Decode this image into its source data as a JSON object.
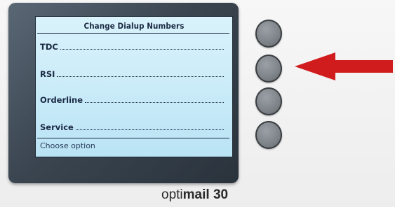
{
  "screen": {
    "title": "Change Dialup Numbers",
    "options": [
      {
        "label": "TDC"
      },
      {
        "label": "RSI"
      },
      {
        "label": "Orderline"
      },
      {
        "label": "Service"
      }
    ],
    "status": "Choose option"
  },
  "brand": {
    "prefix": "opti",
    "suffix": "mail 30"
  },
  "indicator": {
    "target_option": "RSI",
    "arrow_icon": "arrow-left-icon",
    "arrow_color": "#d01c1c"
  },
  "soft_keys": [
    {
      "icon": "round-soft-key",
      "for": "TDC"
    },
    {
      "icon": "round-soft-key",
      "for": "RSI"
    },
    {
      "icon": "round-soft-key",
      "for": "Orderline"
    },
    {
      "icon": "round-soft-key",
      "for": "Service"
    }
  ]
}
